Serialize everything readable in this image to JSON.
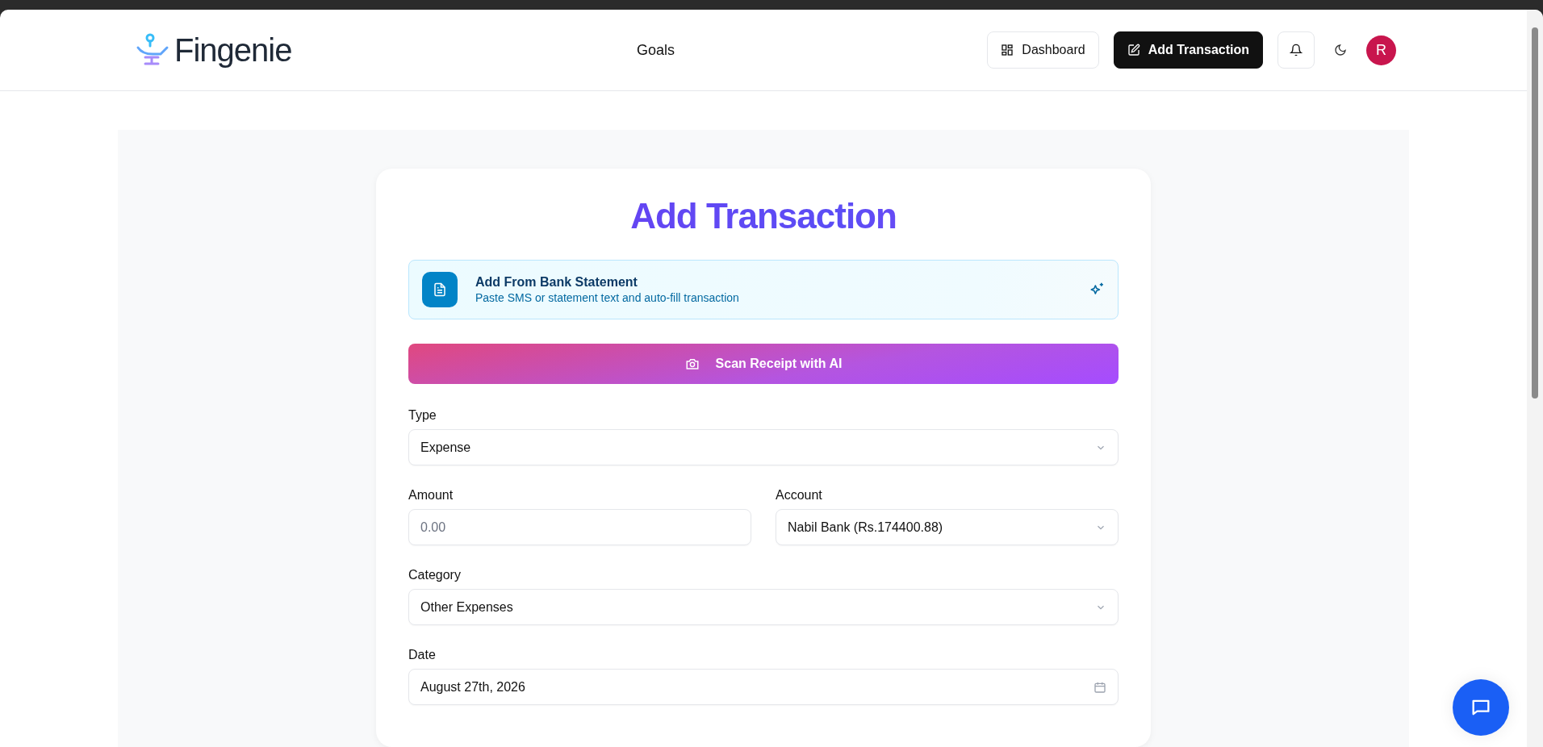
{
  "header": {
    "logo": "Fingenie",
    "nav": [
      {
        "label": "Goals"
      }
    ],
    "buttons": [
      {
        "label": "Dashboard",
        "kind": "outline"
      },
      {
        "label": "Add Transaction",
        "kind": "primary"
      }
    ],
    "avatar": "R"
  },
  "form": {
    "title": "Add Transaction",
    "bank_statement": {
      "title": "Add From Bank Statement",
      "subtitle": "Paste SMS or statement text and auto-fill transaction"
    },
    "scan_button": "Scan Receipt with AI",
    "rows": [
      [
        {
          "label": "Type",
          "kind": "select",
          "value": "Expense"
        }
      ],
      [
        {
          "label": "Amount",
          "kind": "input",
          "placeholder": "0.00"
        },
        {
          "label": "Account",
          "kind": "select",
          "value": "Nabil Bank (Rs.174400.88)"
        }
      ],
      [
        {
          "label": "Category",
          "kind": "select",
          "value": "Other Expenses"
        }
      ],
      [
        {
          "label": "Date",
          "kind": "date",
          "value": "August 27th, 2026"
        }
      ]
    ]
  }
}
